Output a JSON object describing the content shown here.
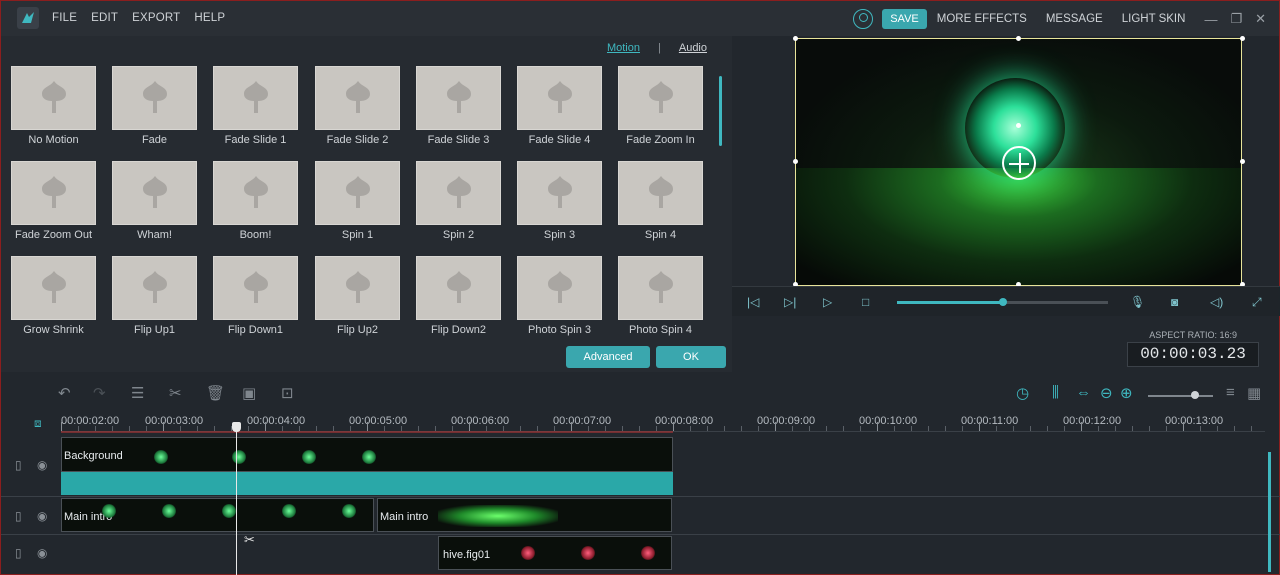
{
  "menu": {
    "file": "FILE",
    "edit": "EDIT",
    "export": "EXPORT",
    "help": "HELP"
  },
  "top": {
    "save": "SAVE",
    "more_effects": "MORE EFFECTS",
    "message": "MESSAGE",
    "light_skin": "LIGHT SKIN"
  },
  "effects": {
    "tab_motion": "Motion",
    "tab_separator": "|",
    "tab_audio": "Audio",
    "items": [
      "No Motion",
      "Fade",
      "Fade Slide 1",
      "Fade Slide 2",
      "Fade Slide 3",
      "Fade Slide 4",
      "Fade Zoom In",
      "Fade Zoom Out",
      "Wham!",
      "Boom!",
      "Spin 1",
      "Spin 2",
      "Spin 3",
      "Spin 4",
      "Grow Shrink",
      "Flip Up1",
      "Flip Down1",
      "Flip Up2",
      "Flip Down2",
      "Photo Spin 3",
      "Photo Spin 4"
    ],
    "advanced": "Advanced",
    "ok": "OK"
  },
  "preview": {
    "aspect_ratio": "ASPECT RATIO: 16:9",
    "timecode": "00:00:03.23",
    "playback_progress": 0.5
  },
  "timeline": {
    "ruler": [
      "00:00:02:00",
      "00:00:03:00",
      "00:00:04:00",
      "00:00:05:00",
      "00:00:06:00",
      "00:00:07:00",
      "00:00:08:00",
      "00:00:09:00",
      "00:00:10:00",
      "00:00:11:00",
      "00:00:12:00",
      "00:00:13:00"
    ],
    "clips": {
      "background": "Background",
      "main_intro_1": "Main intro",
      "main_intro_2": "Main intro",
      "overlay": "hive.fig01"
    },
    "zoom_level": 0.72
  },
  "colors": {
    "accent": "#3aa7ae",
    "teal_track": "#2aa8a8",
    "frame_border": "#e8e49a"
  }
}
